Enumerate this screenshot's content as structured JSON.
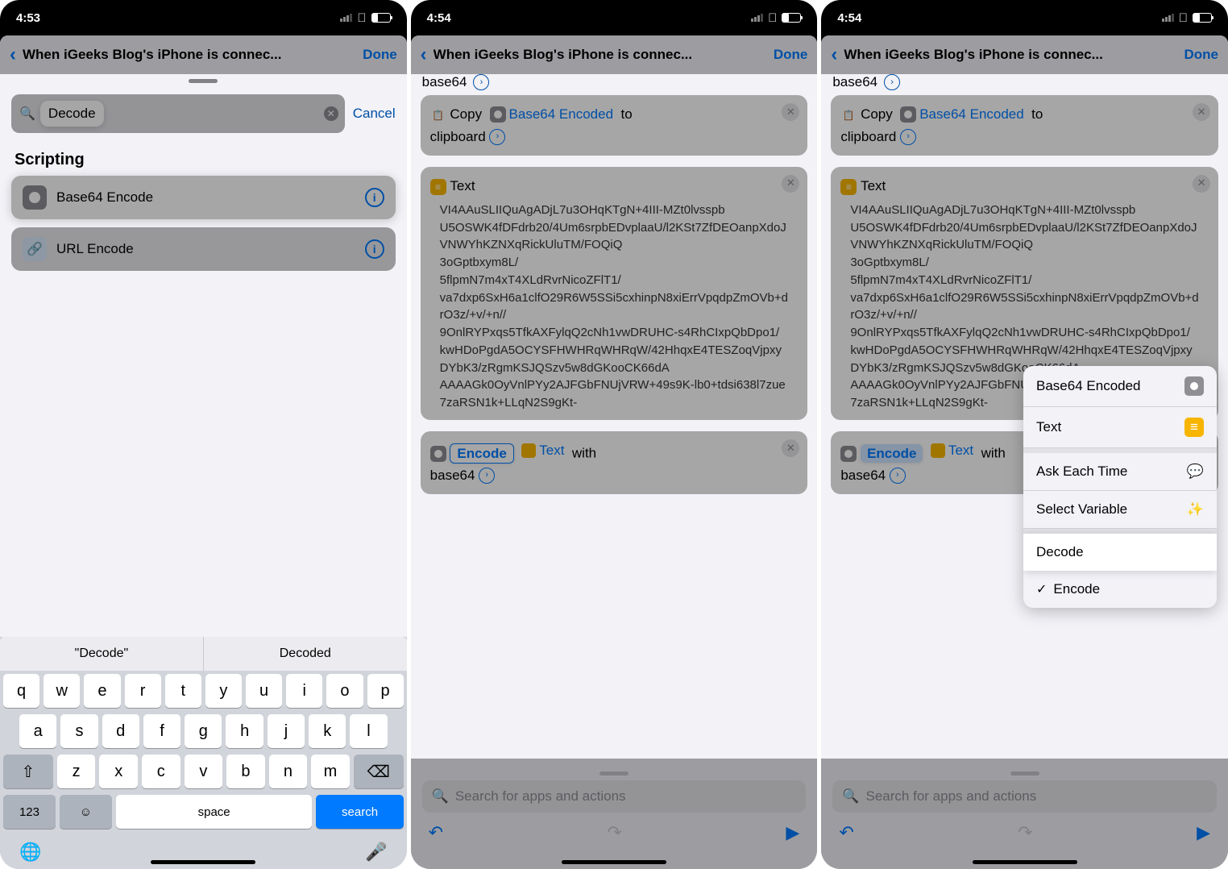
{
  "status": {
    "time1": "4:53",
    "time2": "4:54",
    "time3": "4:54"
  },
  "nav": {
    "title": "When iGeeks Blog's iPhone is connec...",
    "done": "Done"
  },
  "screen1": {
    "search_value": "Decode",
    "cancel": "Cancel",
    "section": "Scripting",
    "item1": "Base64 Encode",
    "item2": "URL Encode",
    "suggest1": "\"Decode\"",
    "suggest2": "Decoded",
    "keys_r1": [
      "q",
      "w",
      "e",
      "r",
      "t",
      "y",
      "u",
      "i",
      "o",
      "p"
    ],
    "keys_r2": [
      "a",
      "s",
      "d",
      "f",
      "g",
      "h",
      "j",
      "k",
      "l"
    ],
    "keys_r3": [
      "z",
      "x",
      "c",
      "v",
      "b",
      "n",
      "m"
    ],
    "k123": "123",
    "space": "space",
    "search": "search"
  },
  "screen2": {
    "base64_label": "base64",
    "copy": "Copy",
    "b64enc": "Base64 Encoded",
    "to": "to",
    "clipboard": "clipboard",
    "text_label": "Text",
    "textbody": "VI4AAuSLIIQuAgADjL7u3OHqKTgN+4III-MZt0lvsspb\nU5OSWK4fDFdrb20/4Um6srpbEDvplaaU/l2KSt7ZfDEOanpXdoJVNWYhKZNXqRickUluTM/FOQiQ\n3oGptbxym8L/\n5flpmN7m4xT4XLdRvrNicoZFlT1/\nva7dxp6SxH6a1clfO29R6W5SSi5cxhinpN8xiErrVpqdpZmOVb+drO3z/+v/+n//\n9OnlRYPxqs5TfkAXFylqQ2cNh1vwDRUHC-s4RhCIxpQbDpo1/\nkwHDoPgdA5OCYSFHWHRqWHRqW/42HhqxE4TESZoqVjpxyDYbK3/zRgmKSJQSzv5w8dGKooCK66dA\nAAAAGk0OyVnlPYy2AJFGbFNUjVRW+49s9K-lb0+tdsi638l7zue7zaRSN1k+LLqN2S9gKt-",
    "encode": "Encode",
    "text_chip": "Text",
    "with": "with",
    "base64b": "base64",
    "search_placeholder": "Search for apps and actions"
  },
  "screen3": {
    "popup": {
      "b64": "Base64 Encoded",
      "text": "Text",
      "ask": "Ask Each Time",
      "sel": "Select Variable",
      "decode": "Decode",
      "encode": "Encode"
    }
  }
}
